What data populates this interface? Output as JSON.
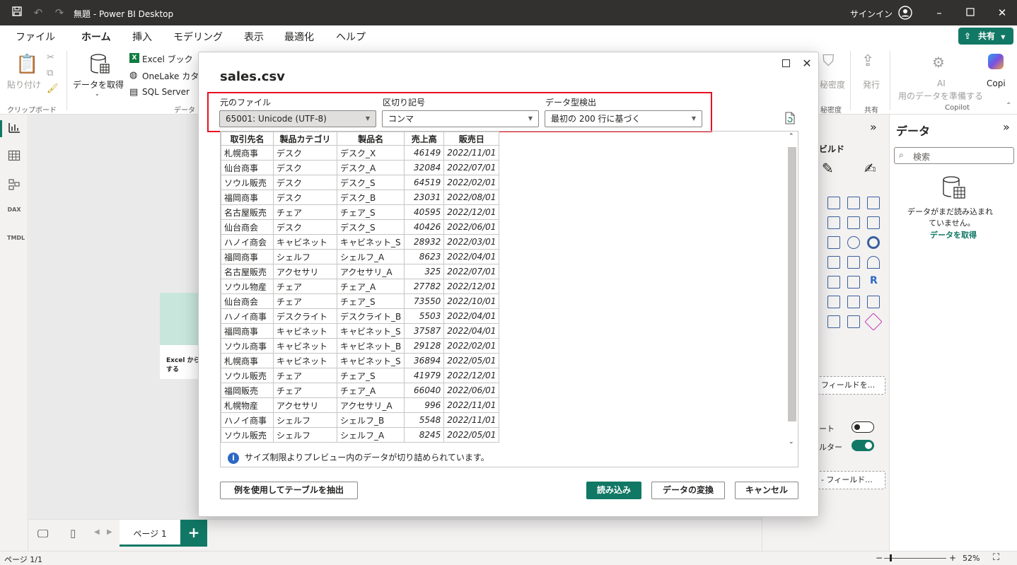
{
  "titlebar": {
    "title": "無題 - Power BI Desktop",
    "signin": "サインイン"
  },
  "menu": {
    "items": [
      "ファイル",
      "ホーム",
      "挿入",
      "モデリング",
      "表示",
      "最適化",
      "ヘルプ"
    ],
    "share": "共有"
  },
  "ribbon": {
    "paste": "貼り付け",
    "clipboard_group": "クリップボード",
    "get_data": "データを取得",
    "excel": "Excel ブック",
    "onelake": "OneLake カタロ",
    "sqlserver": "SQL Server",
    "data_group": "データ",
    "sensitivity": "秘密度",
    "sensitivity_group": "秘密度",
    "publish": "発行",
    "share_group": "共有",
    "ai_line1": "AI",
    "ai_line2": "用のデータを準備する",
    "copilot": "Copi",
    "copilot_group": "Copilot"
  },
  "viz_pane": {
    "build": "ビルド",
    "field_drop": "フィールドを...",
    "toggle1": "ート",
    "toggle2": "ルター",
    "field_drop2": "- フィールド..."
  },
  "data_pane": {
    "title": "データ",
    "search_placeholder": "検索",
    "empty_line1": "データがまだ読み込まれ",
    "empty_line2": "ていません。",
    "get_data": "データを取得"
  },
  "canvas": {
    "card_hint_line1": "Excel から",
    "card_hint_line2": "する"
  },
  "pages": {
    "tab": "ページ 1",
    "add": "+"
  },
  "status": {
    "page": "ページ 1/1",
    "zoom": "52%"
  },
  "dialog": {
    "title": "sales.csv",
    "origin_label": "元のファイル",
    "origin_value": "65001: Unicode (UTF-8)",
    "delimiter_label": "区切り記号",
    "delimiter_value": "コンマ",
    "detect_label": "データ型検出",
    "detect_value": "最初の 200 行に基づく",
    "truncated": "サイズ制限よりプレビュー内のデータが切り詰められています。",
    "btn_extract": "例を使用してテーブルを抽出",
    "btn_load": "読み込み",
    "btn_transform": "データの変換",
    "btn_cancel": "キャンセル",
    "columns": [
      "取引先名",
      "製品カテゴリ",
      "製品名",
      "売上高",
      "販売日"
    ],
    "rows": [
      [
        "札幌商事",
        "デスク",
        "デスク_X",
        "46149",
        "2022/11/01"
      ],
      [
        "仙台商事",
        "デスク",
        "デスク_A",
        "32084",
        "2022/07/01"
      ],
      [
        "ソウル販売",
        "デスク",
        "デスク_S",
        "64519",
        "2022/02/01"
      ],
      [
        "福岡商事",
        "デスク",
        "デスク_B",
        "23031",
        "2022/08/01"
      ],
      [
        "名古屋販売",
        "チェア",
        "チェア_S",
        "40595",
        "2022/12/01"
      ],
      [
        "仙台商会",
        "デスク",
        "デスク_S",
        "40426",
        "2022/06/01"
      ],
      [
        "ハノイ商会",
        "キャビネット",
        "キャビネット_S",
        "28932",
        "2022/03/01"
      ],
      [
        "福岡商事",
        "シェルフ",
        "シェルフ_A",
        "8623",
        "2022/04/01"
      ],
      [
        "名古屋販売",
        "アクセサリ",
        "アクセサリ_A",
        "325",
        "2022/07/01"
      ],
      [
        "ソウル物産",
        "チェア",
        "チェア_A",
        "27782",
        "2022/12/01"
      ],
      [
        "仙台商会",
        "チェア",
        "チェア_S",
        "73550",
        "2022/10/01"
      ],
      [
        "ハノイ商事",
        "デスクライト",
        "デスクライト_B",
        "5503",
        "2022/04/01"
      ],
      [
        "福岡商事",
        "キャビネット",
        "キャビネット_S",
        "37587",
        "2022/04/01"
      ],
      [
        "ソウル商事",
        "キャビネット",
        "キャビネット_B",
        "29128",
        "2022/02/01"
      ],
      [
        "札幌商事",
        "キャビネット",
        "キャビネット_S",
        "36894",
        "2022/05/01"
      ],
      [
        "ソウル販売",
        "チェア",
        "チェア_S",
        "41979",
        "2022/12/01"
      ],
      [
        "福岡販売",
        "チェア",
        "チェア_A",
        "66040",
        "2022/06/01"
      ],
      [
        "札幌物産",
        "アクセサリ",
        "アクセサリ_A",
        "996",
        "2022/11/01"
      ],
      [
        "ハノイ商事",
        "シェルフ",
        "シェルフ_B",
        "5548",
        "2022/11/01"
      ],
      [
        "ソウル販売",
        "シェルフ",
        "シェルフ_A",
        "8245",
        "2022/05/01"
      ]
    ]
  },
  "colors": {
    "accent": "#117865",
    "highlight": "#e81123",
    "titlebar": "#323130"
  }
}
